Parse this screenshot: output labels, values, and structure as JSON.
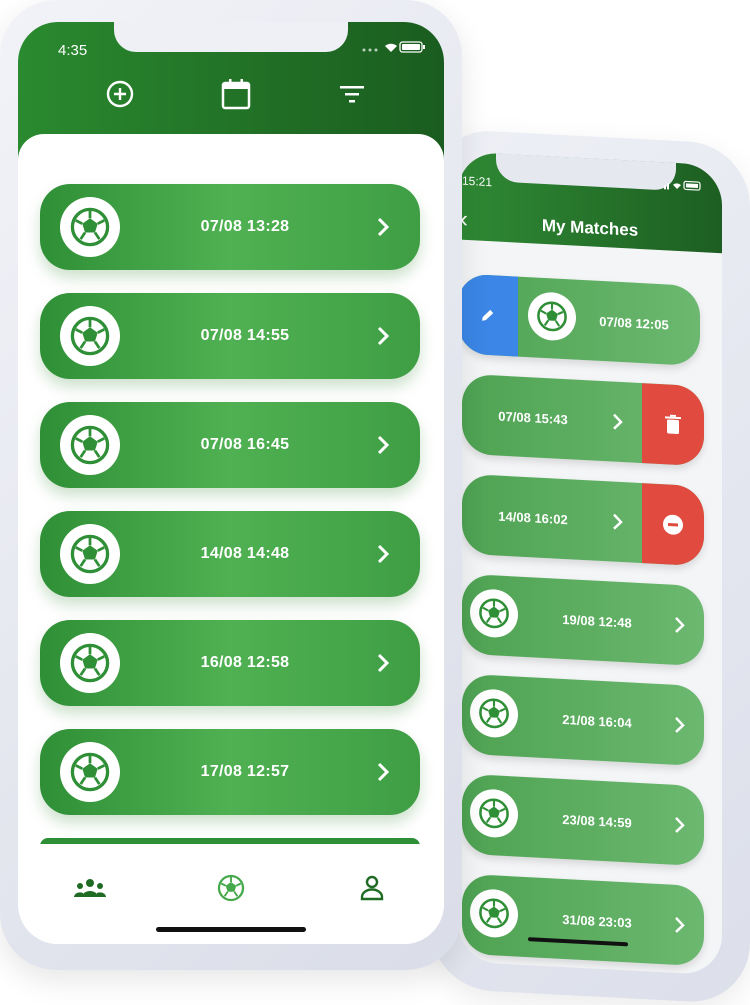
{
  "front_phone": {
    "status_time": "4:35",
    "header_icons": [
      "add-circle-icon",
      "calendar-icon",
      "filter-icon"
    ],
    "matches": [
      {
        "label": "07/08 13:28"
      },
      {
        "label": "07/08 14:55"
      },
      {
        "label": "07/08 16:45"
      },
      {
        "label": "14/08 14:48"
      },
      {
        "label": "16/08 12:58"
      },
      {
        "label": "17/08 12:57"
      }
    ],
    "tabs": [
      "team-icon",
      "soccer-ball-icon",
      "profile-icon"
    ]
  },
  "back_phone": {
    "status_time": "15:21",
    "title": "My Matches",
    "matches": [
      {
        "label": "07/08 12:05",
        "swipe_action": "edit"
      },
      {
        "label": "07/08 15:43",
        "swipe_action": "delete"
      },
      {
        "label": "14/08 16:02",
        "swipe_action": "remove"
      },
      {
        "label": "19/08 12:48"
      },
      {
        "label": "21/08 16:04"
      },
      {
        "label": "23/08 14:59"
      },
      {
        "label": "31/08 23:03"
      }
    ]
  },
  "colors": {
    "primary_green": "#2f8f36",
    "header_dark_green": "#1a5c1f",
    "edit_blue": "#3b86e6",
    "delete_red": "#e14b3f"
  }
}
